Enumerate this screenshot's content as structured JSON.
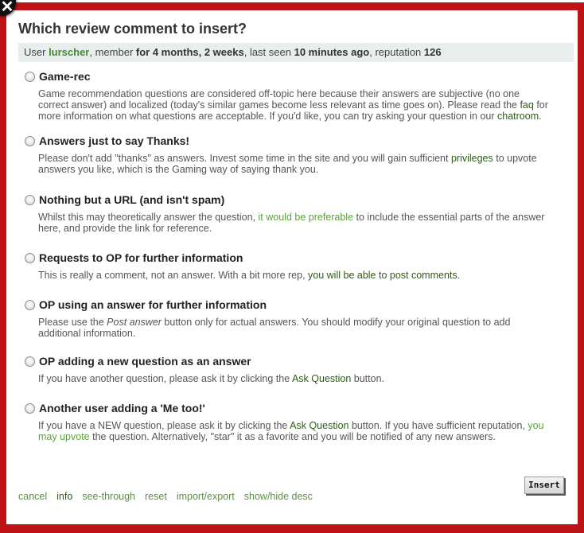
{
  "dialog": {
    "title": "Which review comment to insert?",
    "close_icon": "close-icon",
    "user_info": {
      "prefix": "User ",
      "username": "lurscher",
      "member_prefix": ", member ",
      "member_for": "for 4 months, 2 weeks",
      "seen_prefix": ", last seen ",
      "last_seen": "10 minutes ago",
      "rep_prefix": ", reputation ",
      "reputation": "126"
    },
    "options": [
      {
        "title": "Game-rec",
        "desc": [
          {
            "t": "Game recommendation questions are considered off-topic here because their answers are subjective (no one correct answer) and localized (today's similar games become less relevant as time goes on). Please read the "
          },
          {
            "t": "faq",
            "link": "dark"
          },
          {
            "t": " for more information on what questions are acceptable. If you'd like, you can try asking your question in our "
          },
          {
            "t": "chatroom",
            "link": "dark"
          },
          {
            "t": "."
          }
        ]
      },
      {
        "title": "Answers just to say Thanks!",
        "desc": [
          {
            "t": "Please don't add \"thanks\" as answers. Invest some time in the site and you will gain sufficient "
          },
          {
            "t": "privileges",
            "link": "dark"
          },
          {
            "t": " to upvote answers you like, which is the Gaming way of saying thank you."
          }
        ]
      },
      {
        "title": "Nothing but a URL (and isn't spam)",
        "desc": [
          {
            "t": "Whilst this may theoretically answer the question, "
          },
          {
            "t": "it would be preferable",
            "link": "light"
          },
          {
            "t": " to include the essential parts of the answer here, and provide the link for reference."
          }
        ]
      },
      {
        "title": "Requests to OP for further information",
        "desc": [
          {
            "t": "This is really a comment, not an answer. With a bit more rep, "
          },
          {
            "t": "you will be able to post comments",
            "link": "dark"
          },
          {
            "t": "."
          }
        ]
      },
      {
        "title": "OP using an answer for further information",
        "desc": [
          {
            "t": "Please use the "
          },
          {
            "t": "Post answer",
            "em": true
          },
          {
            "t": " button only for actual answers. You should modify your original question to add additional information."
          }
        ]
      },
      {
        "title": "OP adding a new question as an answer",
        "desc": [
          {
            "t": "If you have another question, please ask it by clicking the "
          },
          {
            "t": "Ask Question",
            "link": "dark"
          },
          {
            "t": " button."
          }
        ]
      },
      {
        "title": "Another user adding a 'Me too!'",
        "desc": [
          {
            "t": "If you have a NEW question, please ask it by clicking the "
          },
          {
            "t": "Ask Question",
            "link": "dark"
          },
          {
            "t": " button. If you have sufficient reputation, "
          },
          {
            "t": "you may upvote",
            "link": "light"
          },
          {
            "t": " the question. Alternatively, \"star\" it as a favorite and you will be notified of any new answers."
          }
        ]
      }
    ],
    "footer_links": [
      "cancel",
      "info",
      "see-through",
      "reset",
      "import/export",
      "show/hide desc"
    ],
    "insert_label": "Insert"
  },
  "colors": {
    "border": "#be1418",
    "link_dark": "#2c5c16",
    "link_light": "#5aa23b",
    "userinfo_bg": "#e8eded"
  }
}
